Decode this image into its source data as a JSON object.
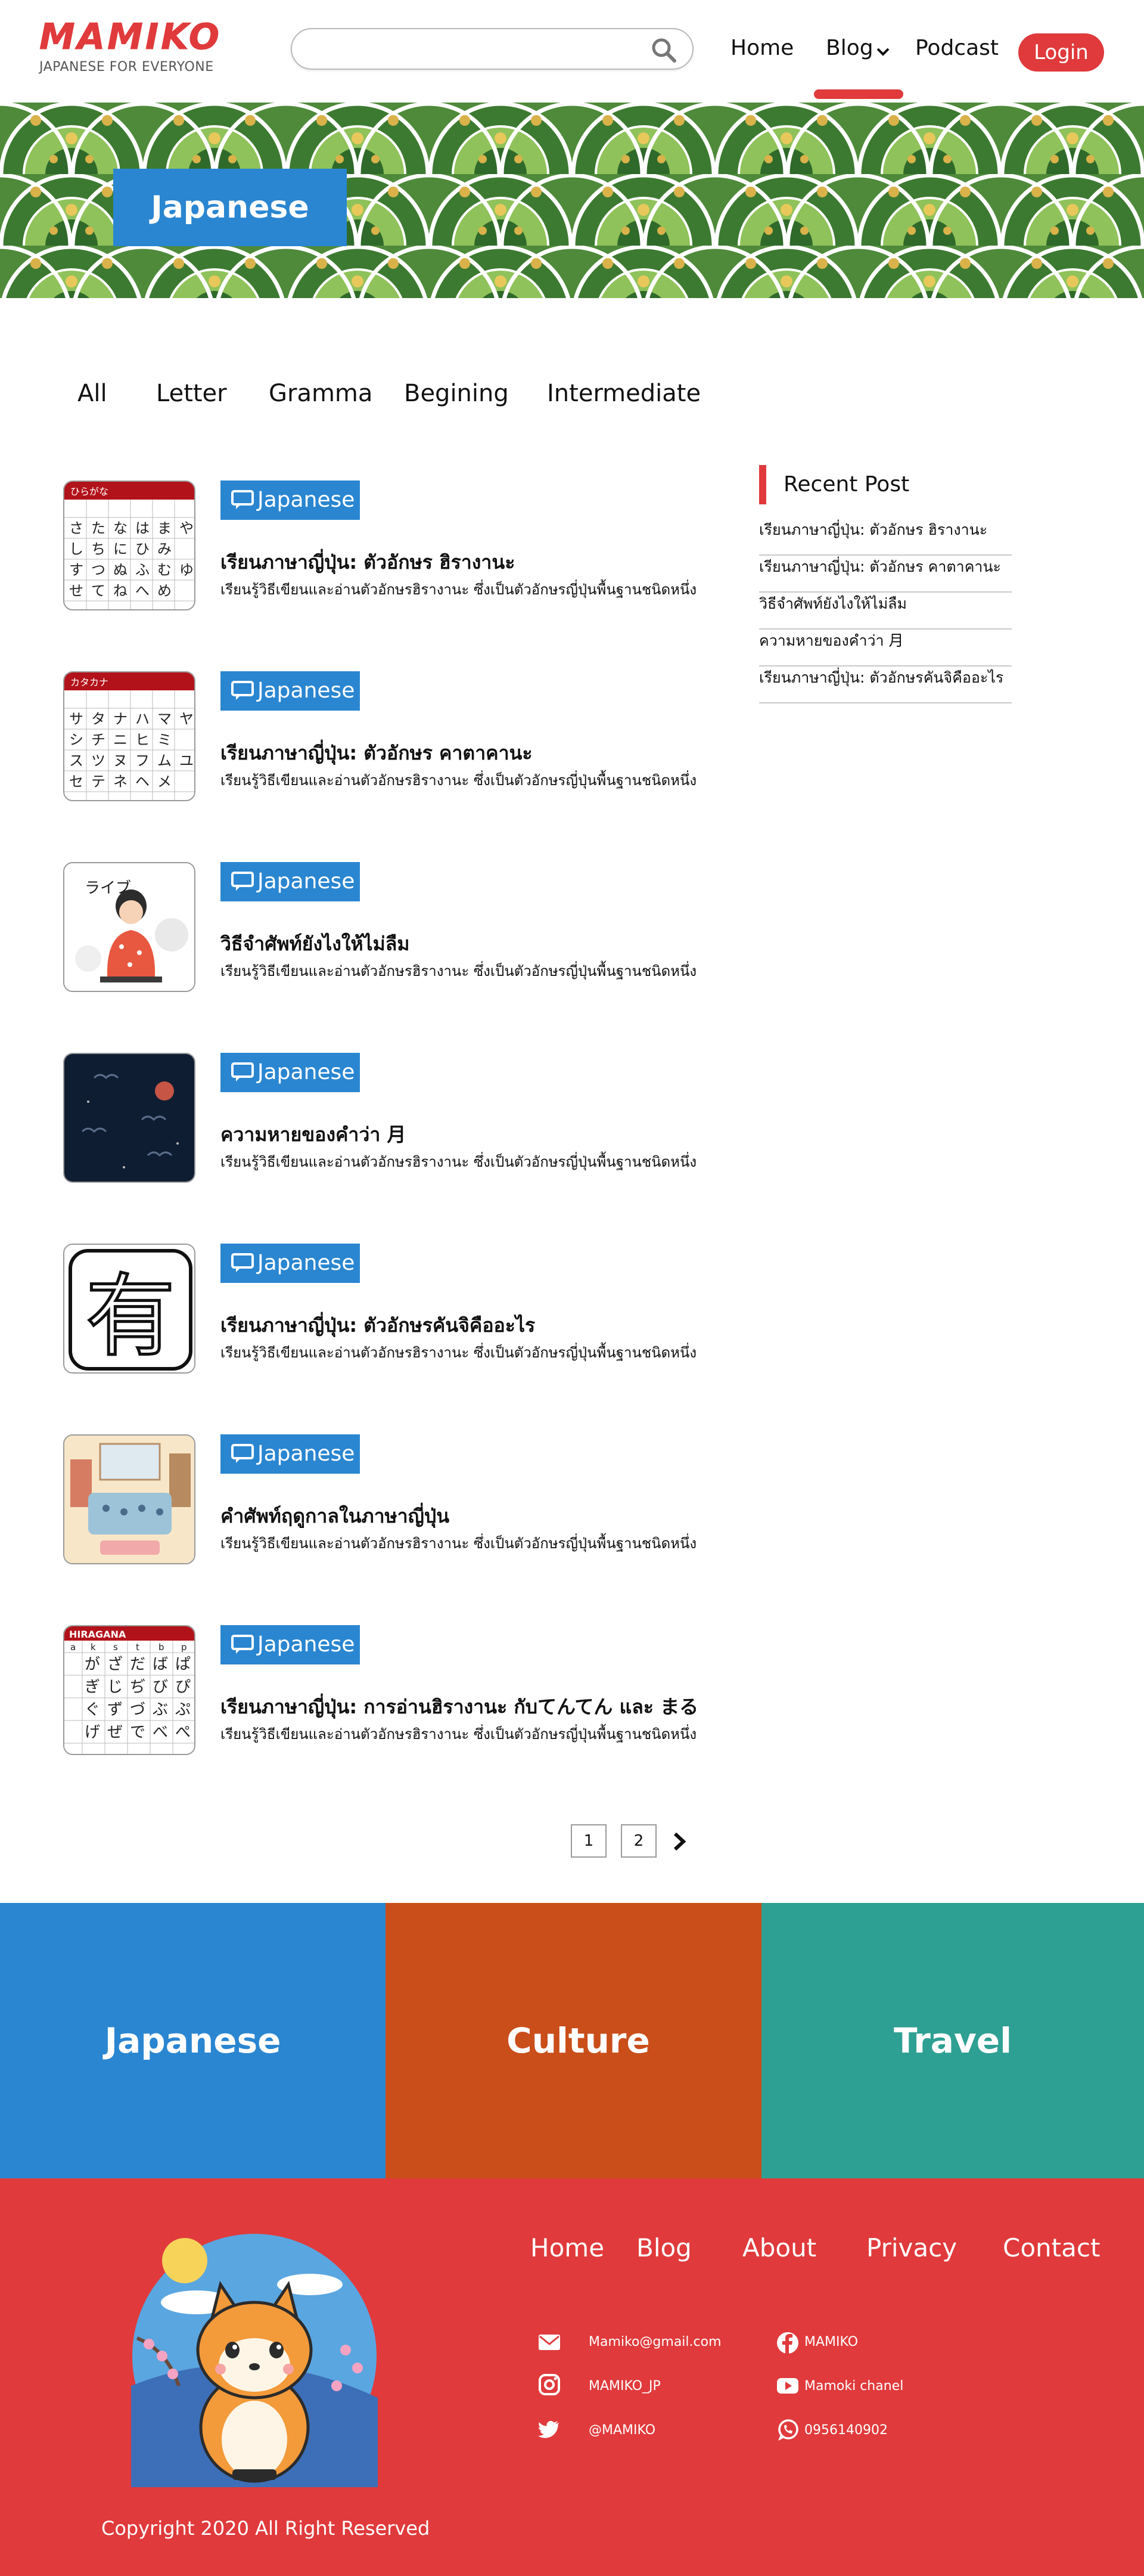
{
  "header": {
    "logo_text": "MAMIKO",
    "logo_subtitle": "JAPANESE FOR EVERYONE",
    "search": {
      "placeholder": "",
      "value": ""
    },
    "nav": {
      "home": "Home",
      "blog": "Blog",
      "podcast": "Podcast"
    },
    "login_label": "Login"
  },
  "hero": {
    "tag": "Japanese"
  },
  "filters": [
    "All",
    "Letter",
    "Gramma",
    "Begining",
    "Intermediate"
  ],
  "posts": [
    {
      "category": "Japanese",
      "title": "เรียนภาษาญี่ปุ่น: ตัวอักษร ฮิรางานะ",
      "excerpt": "เรียนรู้วิธีเขียนและอ่านตัวอักษรฮิรางานะ ซึ่งเป็นตัวอักษรญี่ปุ่นพื้นฐานชนิดหนึ่ง",
      "thumb": "hiragana-chart",
      "thumb_label": "ひらがな"
    },
    {
      "category": "Japanese",
      "title": "เรียนภาษาญี่ปุ่น: ตัวอักษร คาตาคานะ",
      "excerpt": "เรียนรู้วิธีเขียนและอ่านตัวอักษรฮิรางานะ ซึ่งเป็นตัวอักษรญี่ปุ่นพื้นฐานชนิดหนึ่ง",
      "thumb": "katakana-chart",
      "thumb_label": "カタカナ"
    },
    {
      "category": "Japanese",
      "title": "วิธีจำศัพท์ยังไงให้ไม่ลืม",
      "excerpt": "เรียนรู้วิธีเขียนและอ่านตัวอักษรฮิรางานะ ซึ่งเป็นตัวอักษรญี่ปุ่นพื้นฐานชนิดหนึ่ง",
      "thumb": "woman-illustration",
      "thumb_label": "ライブ"
    },
    {
      "category": "Japanese",
      "title": "ความหายของคำว่า 月",
      "excerpt": "เรียนรู้วิธีเขียนและอ่านตัวอักษรฮิรางานะ ซึ่งเป็นตัวอักษรญี่ปุ่นพื้นฐานชนิดหนึ่ง",
      "thumb": "night-sky",
      "thumb_label": ""
    },
    {
      "category": "Japanese",
      "title": "เรียนภาษาญี่ปุ่น: ตัวอักษรคันจิคืออะไร",
      "excerpt": "เรียนรู้วิธีเขียนและอ่านตัวอักษรฮิรางานะ ซึ่งเป็นตัวอักษรญี่ปุ่นพื้นฐานชนิดหนึ่ง",
      "thumb": "kanji-icon",
      "thumb_label": "有"
    },
    {
      "category": "Japanese",
      "title": "คำศัพท์ฤดูกาลในภาษาญี่ปุ่น",
      "excerpt": "เรียนรู้วิธีเขียนและอ่านตัวอักษรฮิรางานะ ซึ่งเป็นตัวอักษรญี่ปุ่นพื้นฐานชนิดหนึ่ง",
      "thumb": "room-illustration",
      "thumb_label": ""
    },
    {
      "category": "Japanese",
      "title": "เรียนภาษาญี่ปุ่น: การอ่านฮิรางานะ กับてんてん และ まる",
      "excerpt": "เรียนรู้วิธีเขียนและอ่านตัวอักษรฮิรางานะ ซึ่งเป็นตัวอักษรญี่ปุ่นพื้นฐานชนิดหนึ่ง",
      "thumb": "hiragana-dakuten-chart",
      "thumb_label": "HIRAGANA"
    }
  ],
  "sidebar": {
    "title": "Recent Post",
    "items": [
      "เรียนภาษาญี่ปุ่น: ตัวอักษร ฮิรางานะ",
      "เรียนภาษาญี่ปุ่น: ตัวอักษร คาตาคานะ",
      "วิธีจำศัพท์ยังไงให้ไม่ลืม",
      "ความหายของคำว่า 月",
      "เรียนภาษาญี่ปุ่น: ตัวอักษรคันจิคืออะไร"
    ]
  },
  "pagination": {
    "pages": [
      "1",
      "2"
    ],
    "current": "1"
  },
  "categories": [
    {
      "label": "Japanese",
      "color": "#2a86d1"
    },
    {
      "label": "Culture",
      "color": "#c94e1a"
    },
    {
      "label": "Travel",
      "color": "#2ea093"
    }
  ],
  "footer": {
    "nav": [
      "Home",
      "Blog",
      "About",
      "Privacy",
      "Contact"
    ],
    "contacts": {
      "email": "Mamiko@gmail.com",
      "instagram": "MAMIKO_JP",
      "twitter": "@MAMIKO",
      "facebook": "MAMIKO",
      "youtube": "Mamoki chanel",
      "whatsapp": "0956140902"
    },
    "copyright": "Copyright 2020 All Right Reserved"
  },
  "colors": {
    "brand_red": "#e03a3c",
    "blue": "#2a86d1",
    "orange": "#c94e1a",
    "teal": "#2ea093"
  }
}
